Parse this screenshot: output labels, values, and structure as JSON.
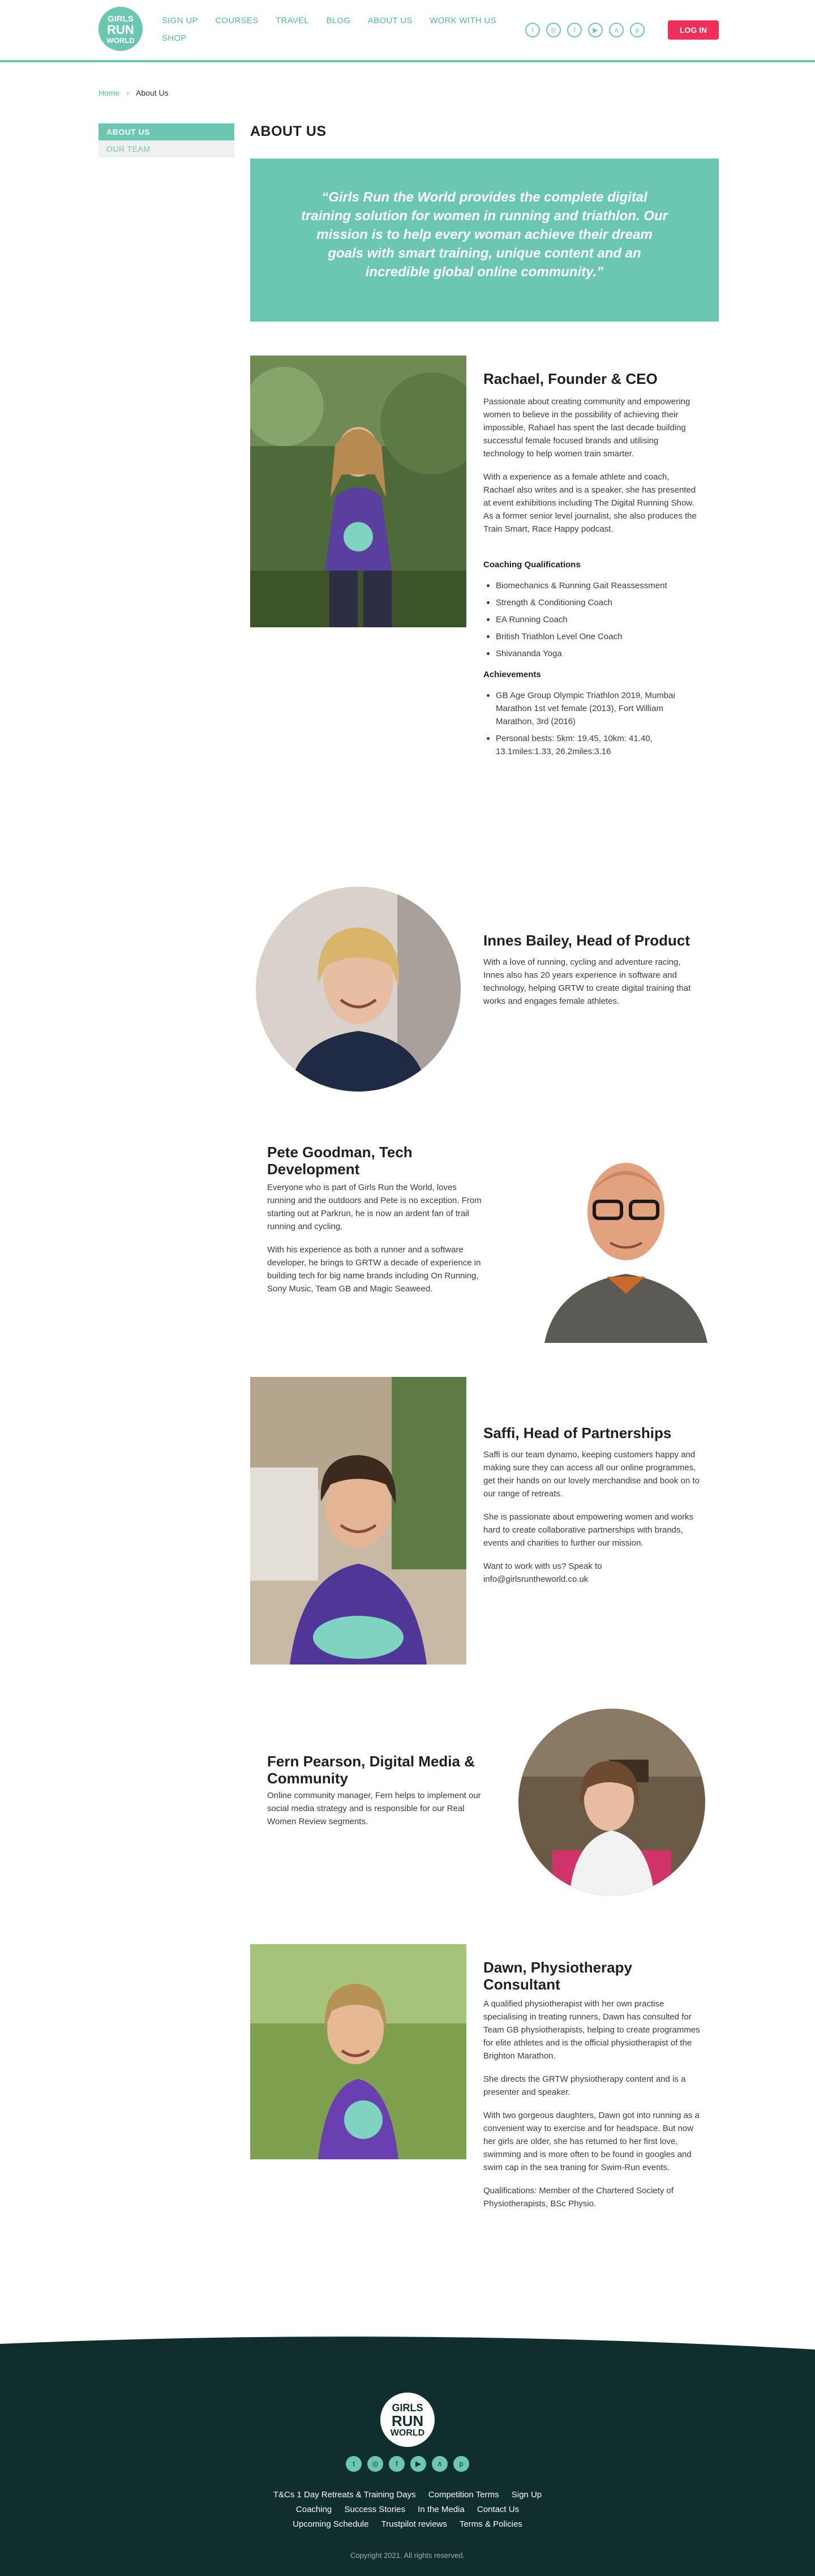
{
  "brand": {
    "logo_lines": [
      "GIRLS",
      "RUN",
      "WORLD"
    ],
    "accent": "#6bc7b2",
    "cta": "#ef2e5a",
    "footer_bg": "#0f2e2c"
  },
  "nav": {
    "items": [
      "SIGN UP",
      "COURSES",
      "TRAVEL",
      "BLOG",
      "ABOUT US",
      "WORK WITH US",
      "SHOP"
    ],
    "login": "LOG IN"
  },
  "socials": [
    "twitter-icon",
    "instagram-icon",
    "facebook-icon",
    "youtube-icon",
    "strava-icon",
    "pinterest-icon"
  ],
  "breadcrumb": {
    "home": "Home",
    "separator": "›",
    "current": "About Us"
  },
  "side_menu": {
    "items": [
      "ABOUT US",
      "OUR TEAM"
    ]
  },
  "page": {
    "title": "ABOUT US",
    "quote": "“Girls Run the World provides the complete digital training solution for women in running and triathlon. Our mission is to help every woman achieve their dream goals with smart training, unique content and an incredible global online community.”"
  },
  "team": [
    {
      "name": "Rachael, Founder & CEO",
      "paragraphs": [
        "Passionate about creating community and empowering women to believe in the possibility of achieving their impossible, Rahael has spent the last decade building successful female focused brands and utilising technology to help women train smarter.",
        "With a experience as a female athlete and coach, Rachael also writes and is a speaker, she has presented at event exhibitions including The Digital Running Show. As a former senior level journalist, she also produces the Train Smart, Race Happy podcast."
      ],
      "qualifications_title": "Coaching Qualifications",
      "qualifications": [
        "Biomechanics & Running Gait Reassessment",
        "Strength & Conditioning Coach",
        "EA Running Coach",
        "British Triathlon Level One Coach",
        "Shivananda Yoga"
      ],
      "achievements_title": "Achievements",
      "achievements": [
        "GB Age Group Olympic Triathlon 2019, Mumbai Marathon 1st vet female (2013), Fort William Marathon, 3rd (2016)",
        "Personal bests: 5km: 19.45, 10km: 41.40, 13.1miles:1.33, 26.2miles:3.16"
      ]
    },
    {
      "name": "Innes Bailey, Head of Product",
      "paragraphs": [
        "With a love of running, cycling and adventure racing, Innes also has 20 years experience in software and technology, helping GRTW to create digital training that works and engages female athletes."
      ]
    },
    {
      "name": "Pete Goodman, Tech Development",
      "paragraphs": [
        "Everyone who is part of Girls Run the World, loves running and the outdoors and Pete is no exception. From starting out at Parkrun, he is now an ardent fan of trail running and cycling.",
        "With his experience as both a runner and a software developer, he brings to GRTW a decade of experience in building tech for big name brands including On Running, Sony Music, Team GB and Magic Seaweed."
      ]
    },
    {
      "name": "Saffi, Head of Partnerships",
      "paragraphs": [
        "Saffi is our team dynamo, keeping customers happy and making sure they can access all our online programmes, get their hands on our lovely merchandise and book on to our range of retreats.",
        "She is passionate about empowering women and works hard to create collaborative partnerships with brands, events and charities to further our mission.",
        "Want to work with us? Speak to info@girlsruntheworld.co.uk"
      ]
    },
    {
      "name": "Fern Pearson, Digital Media & Community",
      "paragraphs": [
        "Online community manager, Fern helps to implement our social media strategy and is responsible for our Real Women Review segments."
      ]
    },
    {
      "name": "Dawn, Physiotherapy Consultant",
      "paragraphs": [
        "A qualified physiotherapist with her own practise specialising in treating runners, Dawn has consulted for Team GB physiotherapists, helping to create programmes for elite athletes and is the official physiotherapist of the Brighton Marathon.",
        "She directs the GRTW  physiotherapy content and is a presenter and speaker.",
        "With two gorgeous daughters, Dawn got into running as a convenient way to exercise and for headspace. But now her girls are older, she has returned to her first love, swimming and is more often to be found in googles and swim cap in the sea traning for Swim-Run events.",
        "Qualifications: Member of the Chartered Society of Physiotherapists, BSc Physio."
      ]
    }
  ],
  "footer": {
    "links_row1": [
      "T&Cs 1 Day Retreats & Training Days",
      "Competition Terms",
      "Sign Up"
    ],
    "links_row2": [
      "Coaching",
      "Success Stories",
      "In the Media",
      "Contact Us"
    ],
    "links_row3": [
      "Upcoming Schedule",
      "Trustpilot reviews",
      "Terms & Policies"
    ],
    "copyright": "Copyright 2021. All rights reserved."
  }
}
